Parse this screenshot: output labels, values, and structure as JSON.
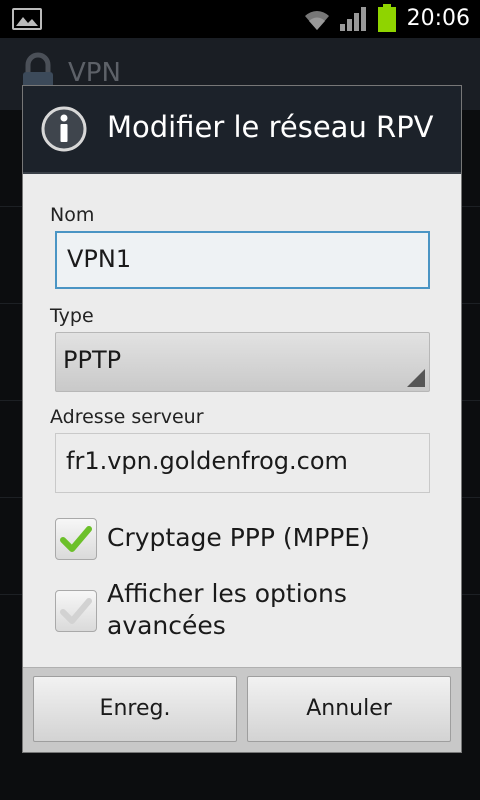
{
  "status_bar": {
    "time": "20:06",
    "icons": [
      "image-notification-icon",
      "wifi-icon",
      "signal-icon",
      "battery-icon"
    ],
    "battery_color": "#8fd400"
  },
  "background_app": {
    "title": "VPN",
    "icon": "lock-icon"
  },
  "dialog": {
    "title": "Modifier le réseau RPV",
    "icon": "info-icon",
    "fields": {
      "name": {
        "label": "Nom",
        "value": "VPN1"
      },
      "type": {
        "label": "Type",
        "value": "PPTP"
      },
      "server": {
        "label": "Adresse serveur",
        "value": "fr1.vpn.goldenfrog.com"
      }
    },
    "checkboxes": [
      {
        "label": "Cryptage PPP (MPPE)",
        "checked": true
      },
      {
        "label_line1": "Afficher les options",
        "label_line2": "avancées",
        "checked": false
      }
    ],
    "buttons": {
      "save": "Enreg.",
      "cancel": "Annuler"
    },
    "colors": {
      "focus_border": "#4a95c4",
      "check_green": "#6cc02a",
      "header_bg": "#1c222a"
    }
  }
}
